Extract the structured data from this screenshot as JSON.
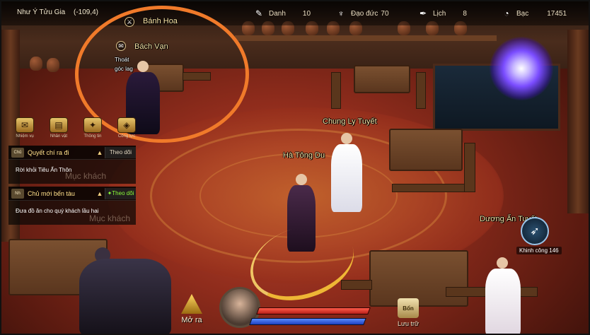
{
  "hud": {
    "location": "Như Ý Tửu Gia",
    "coords": "(-109,4)",
    "stats": [
      {
        "icon": "fame-icon",
        "label": "Danh",
        "value": "10"
      },
      {
        "icon": "morality-icon",
        "label": "Đạo đức",
        "value": "70"
      },
      {
        "icon": "calendar-icon",
        "label": "Lịch",
        "value": "8"
      },
      {
        "icon": "silver-icon",
        "label": "Bạc",
        "value": "17451"
      }
    ]
  },
  "npcs": {
    "banh_hoa": "Bánh Hoa",
    "bach_van": "Bách Vạn",
    "exit_corner": "Thoát góc lag",
    "chung_ly_tuyet": "Chung Ly Tuyết",
    "ha_tong_du": "Hà Tông Du",
    "duong_an_tuyet": "Dương Ẩn Tuyết"
  },
  "quest_icons": [
    {
      "icon": "scroll-icon",
      "label": "Nhiệm vụ"
    },
    {
      "icon": "book-icon",
      "label": "Nhân vật"
    },
    {
      "icon": "mount-icon",
      "label": "Thông tin"
    },
    {
      "icon": "bag-icon",
      "label": "Công lực"
    }
  ],
  "quests": [
    {
      "tag": "Chủ",
      "title": "Quyết chí ra đi",
      "follow": "Theo dõi",
      "body": "Rời khỏi Tiêu Ẩn Thôn"
    },
    {
      "tag": "Nh",
      "title": "Chủ mới bến tàu",
      "follow": "Theo dõi",
      "body": "Đưa đồ ăn cho quý khách lầu hai"
    }
  ],
  "ghost_texts": [
    "Mục khách",
    "Mục khách"
  ],
  "bottom": {
    "mo_ra": "Mở ra",
    "luu_tru_icon": "Bổn",
    "luu_tru": "Lưu trữ",
    "skill_label": "Khinh công 146"
  },
  "bars": {
    "hp": 0.95,
    "mp": 0.95
  },
  "colors": {
    "highlight": "#f07a2a",
    "quest_title": "#ffe08a",
    "follow_active": "#8cff3a"
  }
}
